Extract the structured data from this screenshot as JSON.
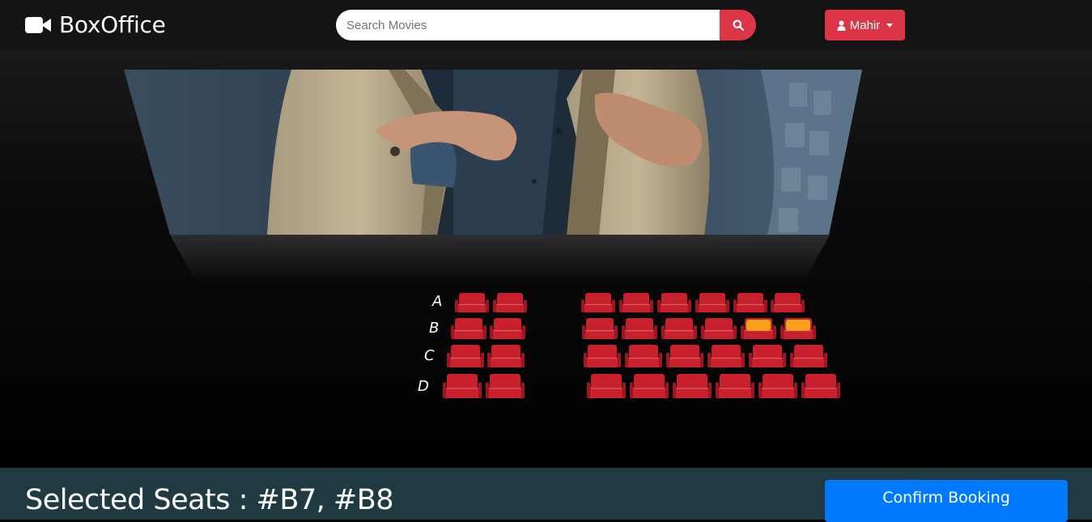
{
  "brand": {
    "name": "BoxOffice",
    "icon": "video-camera-icon"
  },
  "search": {
    "placeholder": "Search Movies",
    "value": "",
    "button_icon": "search-icon"
  },
  "user": {
    "name": "Mahir",
    "icon": "user-icon"
  },
  "seating": {
    "rows": [
      "A",
      "B",
      "C",
      "D"
    ],
    "seats_per_row": 8,
    "selected": [
      "B7",
      "B8"
    ],
    "colors": {
      "available": "#c8202d",
      "selected": "#f7a01b",
      "screen_bg": "#000000"
    }
  },
  "footer": {
    "selected_label": "Selected Seats : #B7, #B8",
    "confirm_label": "Confirm Booking"
  },
  "colors": {
    "accent": "#dc3545",
    "primary": "#007bff",
    "bottom_bar": "#1f3a40"
  }
}
